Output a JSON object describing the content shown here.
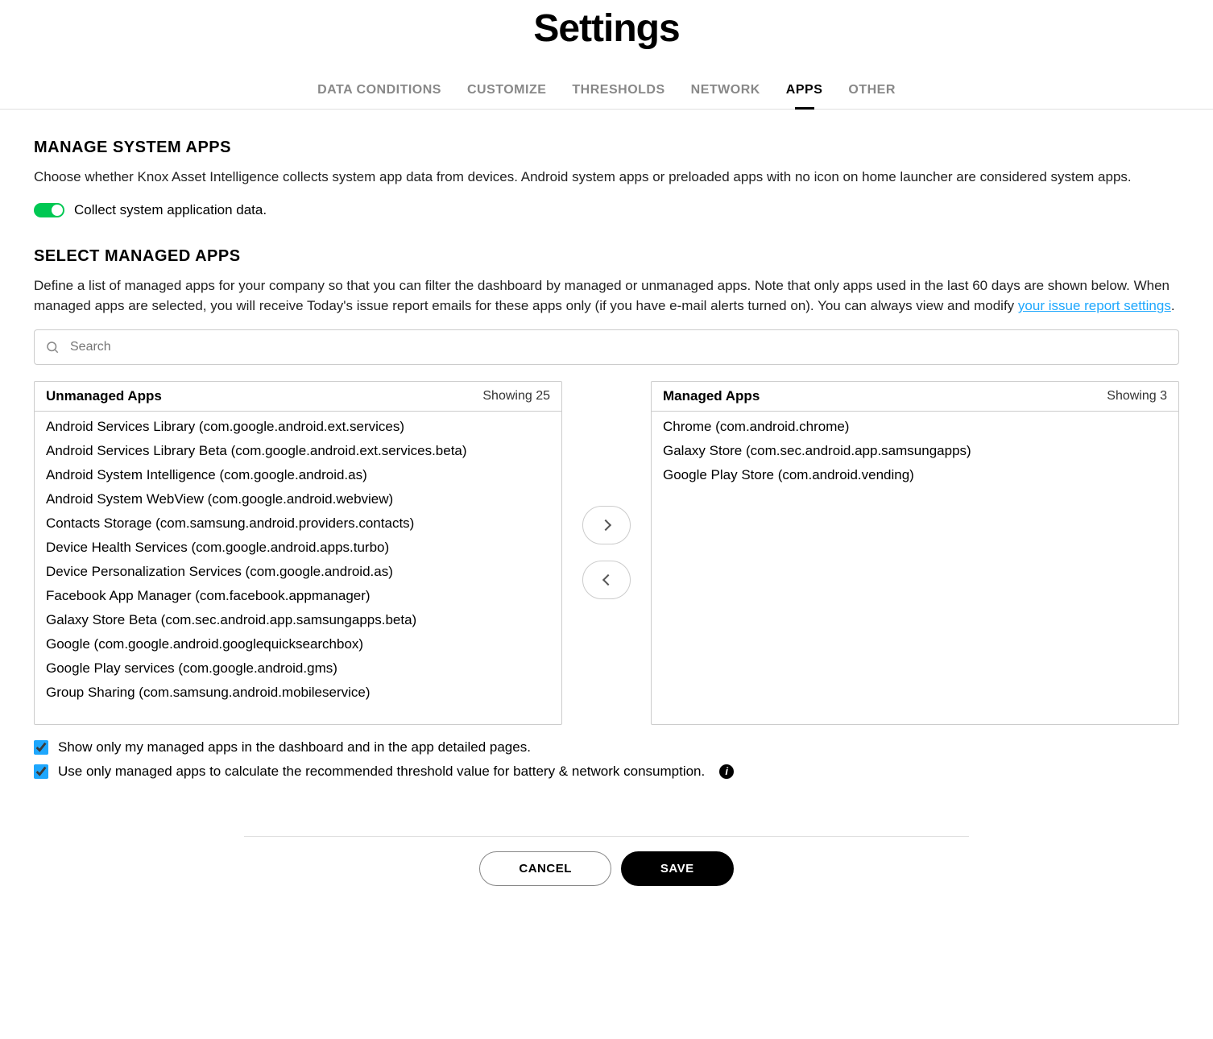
{
  "page_title": "Settings",
  "tabs": [
    {
      "label": "DATA CONDITIONS",
      "active": false
    },
    {
      "label": "CUSTOMIZE",
      "active": false
    },
    {
      "label": "THRESHOLDS",
      "active": false
    },
    {
      "label": "NETWORK",
      "active": false
    },
    {
      "label": "APPS",
      "active": true
    },
    {
      "label": "OTHER",
      "active": false
    }
  ],
  "manage_section": {
    "title": "MANAGE SYSTEM APPS",
    "description": "Choose whether Knox Asset Intelligence collects system app data from devices. Android system apps or preloaded apps with no icon on home launcher are considered system apps.",
    "toggle_label": "Collect system application data."
  },
  "select_section": {
    "title": "SELECT MANAGED APPS",
    "description_prefix": "Define a list of managed apps for your company so that you can filter the dashboard by managed or unmanaged apps. Note that only apps used in the last 60 days are shown below. When managed apps are selected, you will receive Today's issue report emails for these apps only (if you have e-mail alerts turned on). You can always view and modify ",
    "link_text": "your issue report settings",
    "description_suffix": ".",
    "search_placeholder": "Search"
  },
  "unmanaged": {
    "title": "Unmanaged Apps",
    "count_label": "Showing 25",
    "items": [
      "Android Services Library (com.google.android.ext.services)",
      "Android Services Library Beta (com.google.android.ext.services.beta)",
      "Android System Intelligence (com.google.android.as)",
      "Android System WebView (com.google.android.webview)",
      "Contacts Storage (com.samsung.android.providers.contacts)",
      "Device Health Services (com.google.android.apps.turbo)",
      "Device Personalization Services (com.google.android.as)",
      "Facebook App Manager (com.facebook.appmanager)",
      "Galaxy Store Beta (com.sec.android.app.samsungapps.beta)",
      "Google (com.google.android.googlequicksearchbox)",
      "Google Play services (com.google.android.gms)",
      "Group Sharing (com.samsung.android.mobileservice)"
    ]
  },
  "managed": {
    "title": "Managed Apps",
    "count_label": "Showing 3",
    "items": [
      "Chrome (com.android.chrome)",
      "Galaxy Store (com.sec.android.app.samsungapps)",
      "Google Play Store (com.android.vending)"
    ]
  },
  "checkboxes": {
    "show_only_managed": "Show only my managed apps in the dashboard and in the app detailed pages.",
    "use_only_managed": "Use only managed apps to calculate the recommended threshold value for battery & network consumption."
  },
  "buttons": {
    "cancel": "CANCEL",
    "save": "SAVE"
  }
}
